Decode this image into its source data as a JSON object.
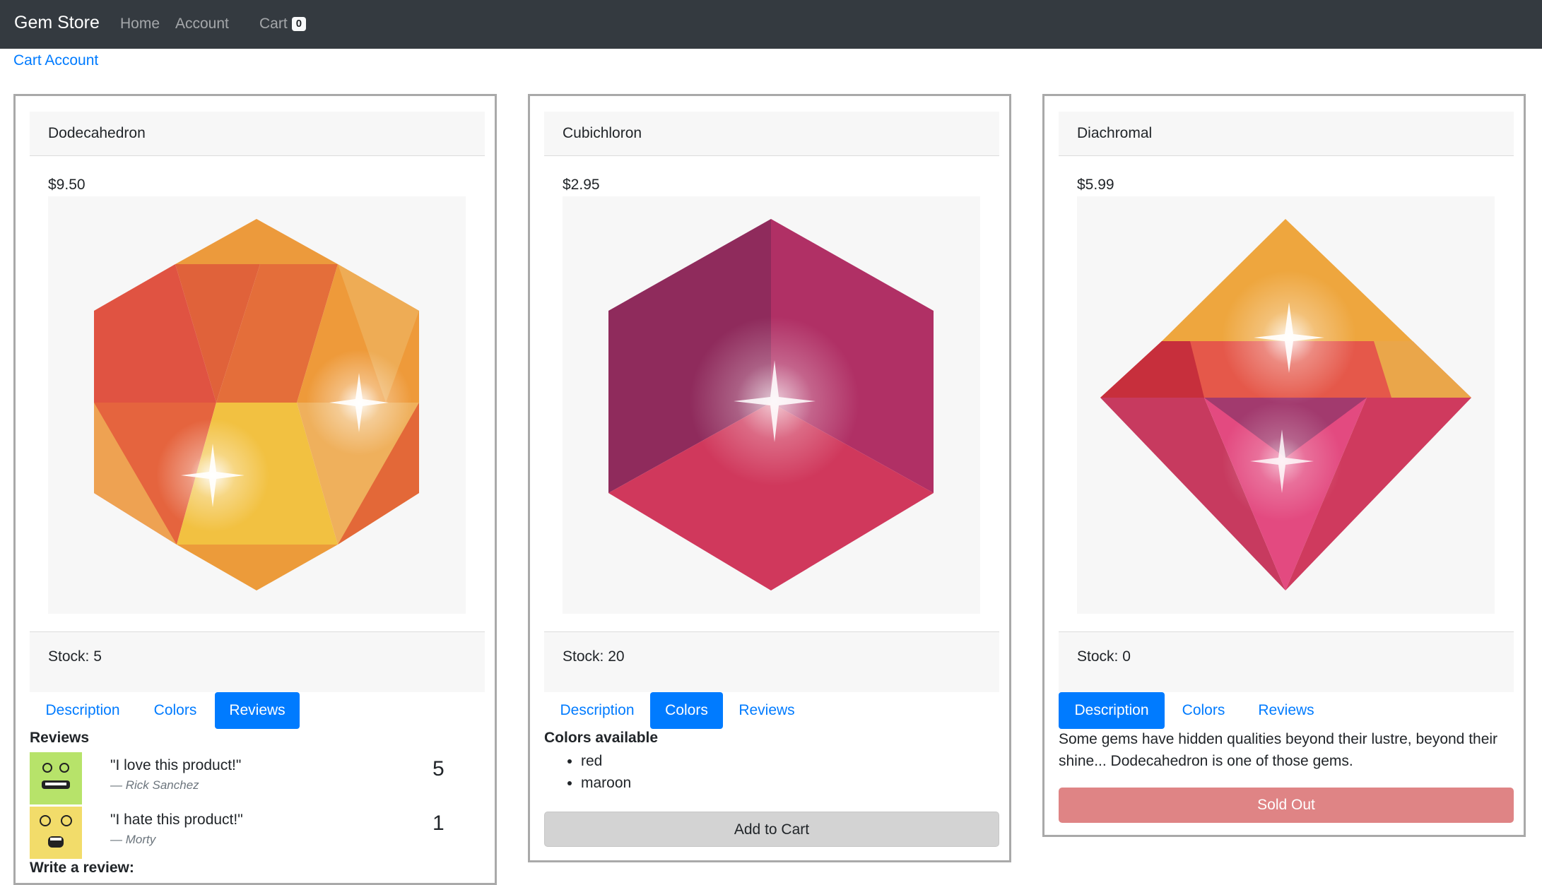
{
  "navbar": {
    "brand": "Gem Store",
    "links": [
      "Home",
      "Account"
    ],
    "cart_label": "Cart",
    "cart_count": "0"
  },
  "subnav": {
    "link": "Cart Account"
  },
  "products": [
    {
      "name": "Dodecahedron",
      "price": "$9.50",
      "stock_label": "Stock: 5",
      "tabs": [
        "Description",
        "Colors",
        "Reviews"
      ],
      "active_tab": "Reviews",
      "reviews_title": "Reviews",
      "reviews": [
        {
          "body": "\"I love this product!\"",
          "author": "— Rick Sanchez",
          "stars": "5",
          "avatar_color": "#b7e36a"
        },
        {
          "body": "\"I hate this product!\"",
          "author": "— Morty",
          "stars": "1",
          "avatar_color": "#f2dc6a"
        }
      ],
      "write_review_label": "Write a review:"
    },
    {
      "name": "Cubichloron",
      "price": "$2.95",
      "stock_label": "Stock: 20",
      "tabs": [
        "Description",
        "Colors",
        "Reviews"
      ],
      "active_tab": "Colors",
      "colors_title": "Colors available",
      "colors": [
        "red",
        "maroon"
      ],
      "button_label": "Add to Cart"
    },
    {
      "name": "Diachromal",
      "price": "$5.99",
      "stock_label": "Stock: 0",
      "tabs": [
        "Description",
        "Colors",
        "Reviews"
      ],
      "active_tab": "Description",
      "description": "Some gems have hidden qualities beyond their lustre, beyond their shine... Dodecahedron is one of those gems.",
      "button_label": "Sold Out"
    }
  ],
  "colors": {
    "navbar_bg": "#343a40",
    "link": "#007bff",
    "card_border": "#a9a9a9",
    "panel_bg": "#f7f7f7",
    "add_to_cart_bg": "#d3d3d3",
    "sold_out_bg": "#df8485"
  },
  "icons": [
    "dodecahedron-gem-icon",
    "cubichloron-gem-icon",
    "diachromal-gem-icon",
    "reviewer-avatar-icon"
  ]
}
